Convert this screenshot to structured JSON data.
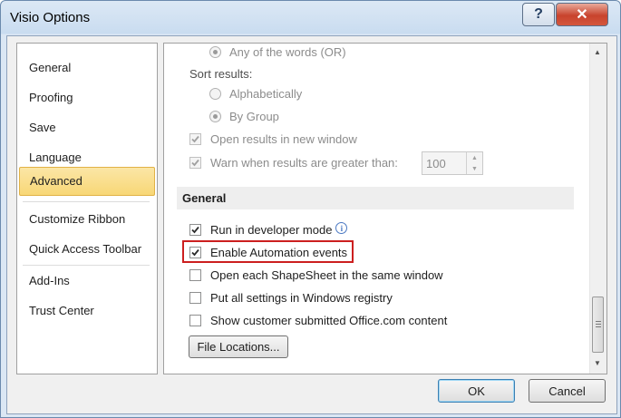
{
  "window": {
    "title": "Visio Options",
    "help_label": "?",
    "close_label": "✕"
  },
  "nav": {
    "items": [
      {
        "label": "General"
      },
      {
        "label": "Proofing"
      },
      {
        "label": "Save"
      },
      {
        "label": "Language"
      },
      {
        "label": "Advanced",
        "selected": true
      },
      {
        "label": "Customize Ribbon"
      },
      {
        "label": "Quick Access Toolbar"
      },
      {
        "label": "Add-Ins"
      },
      {
        "label": "Trust Center"
      }
    ]
  },
  "search": {
    "any_words": "Any of the words (OR)",
    "sort_label": "Sort results:",
    "alphabetically": "Alphabetically",
    "by_group": "By Group",
    "open_new_window": "Open results in new window",
    "warn_greater": "Warn when results are greater than:",
    "warn_value": "100"
  },
  "general": {
    "header": "General",
    "developer_mode": "Run in developer mode",
    "automation_events": "Enable Automation events",
    "shapesheet_same_window": "Open each ShapeSheet in the same window",
    "registry": "Put all settings in Windows registry",
    "office_content": "Show customer submitted Office.com content",
    "file_locations": "File Locations..."
  },
  "buttons": {
    "ok": "OK",
    "cancel": "Cancel"
  },
  "colors": {
    "highlight": "#cc1f1f",
    "selected_nav": "#f8d776"
  }
}
